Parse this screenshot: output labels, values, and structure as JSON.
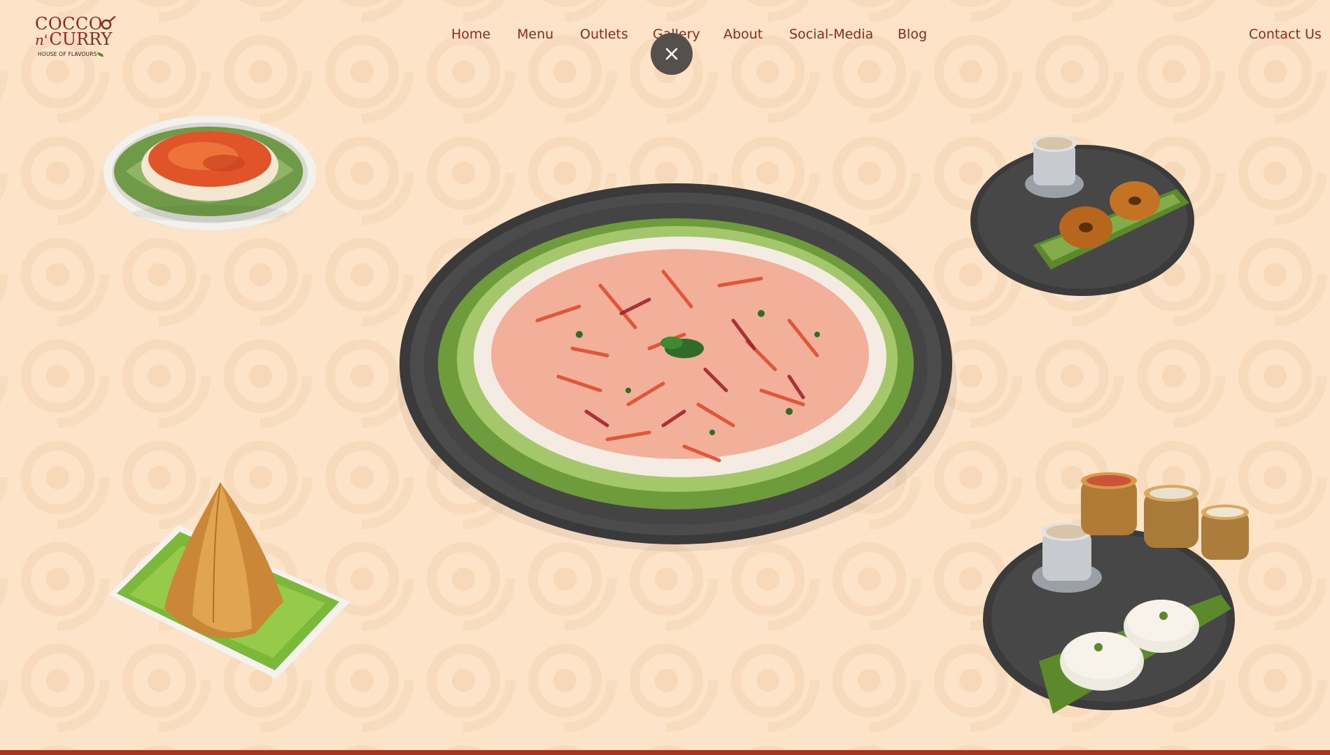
{
  "brand": {
    "logo_line1": "COCCO",
    "logo_line2_mark": "n'",
    "logo_line2": "CURRY",
    "tagline": "HOUSE OF FLAVOURS"
  },
  "nav": {
    "items": [
      "Home",
      "Menu",
      "Outlets",
      "Gallery",
      "About",
      "Social-Media",
      "Blog"
    ],
    "contact": "Contact Us"
  },
  "overlay": {
    "close_icon": "close-icon"
  },
  "gallery": {
    "images": [
      {
        "name": "masala-idli-plate"
      },
      {
        "name": "uttapam-plate"
      },
      {
        "name": "medu-vada-coffee-plate"
      },
      {
        "name": "cone-dosa-plate"
      },
      {
        "name": "idli-coffee-chutney-plate"
      }
    ]
  },
  "colors": {
    "background": "#fde3c7",
    "accent": "#8b2b20",
    "bottom_bar": "#a8341f",
    "close_button": "#56504d"
  }
}
